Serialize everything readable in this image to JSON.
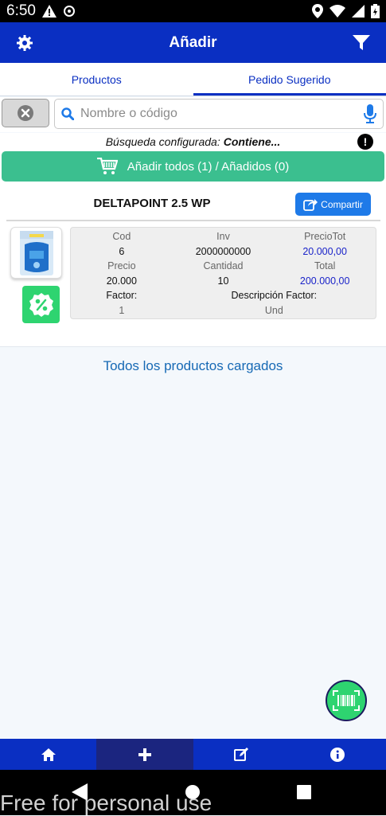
{
  "status_bar": {
    "time": "6:50"
  },
  "app_bar": {
    "title": "Añadir"
  },
  "tabs": [
    {
      "label": "Productos",
      "active": false
    },
    {
      "label": "Pedido Sugerido",
      "active": true
    }
  ],
  "search": {
    "placeholder": "Nombre o código",
    "value": ""
  },
  "config": {
    "label": "Búsqueda configurada:",
    "value": "Contiene..."
  },
  "add_all": {
    "label": "Añadir todos (1) / Añadidos (0)"
  },
  "product": {
    "name": "DELTAPOINT 2.5 WP",
    "share_label": "Compartir",
    "fields": {
      "cod_label": "Cod",
      "cod": "6",
      "inv_label": "Inv",
      "inv": "2000000000",
      "preciotot_label": "PrecioTot",
      "preciotot": "20.000,00",
      "precio_label": "Precio",
      "precio": "20.000",
      "cantidad_label": "Cantidad",
      "cantidad": "10",
      "total_label": "Total",
      "total": "200.000,00",
      "factor_label": "Factor:",
      "factor": "1",
      "descfactor_label": "Descripción Factor:",
      "descfactor": "Und"
    }
  },
  "loaded_text": "Todos los productos cargados",
  "watermark": "Free for personal use",
  "colors": {
    "primary": "#0a2fc2",
    "accent_green": "#3bbf8f",
    "fab_green": "#2ed470",
    "value_blue": "#1a23c9"
  },
  "icons": [
    "gear-icon",
    "filter-icon",
    "clear-icon",
    "search-icon",
    "mic-icon",
    "info-icon",
    "cart-icon",
    "share-icon",
    "discount-icon",
    "barcode-icon",
    "home-icon",
    "plus-icon",
    "edit-icon",
    "info-circle-icon"
  ]
}
